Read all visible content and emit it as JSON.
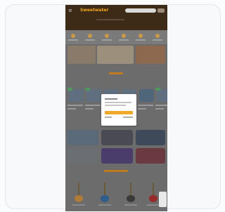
{
  "header": {
    "logo": "Sweetwater"
  },
  "colors": {
    "card_background": "#f7f9fb",
    "card_border": "#e1e6ec",
    "overlay_dim": "#6c6c6c",
    "header_background": "#3d2a17",
    "accent": "#f3a81d",
    "modal_background": "#ffffff",
    "modal_button": "#f0a92a"
  },
  "icons": {
    "menu": "menu-icon",
    "account": "account-icon"
  },
  "products": {
    "count": 6
  },
  "guitars": {
    "count": 6
  }
}
